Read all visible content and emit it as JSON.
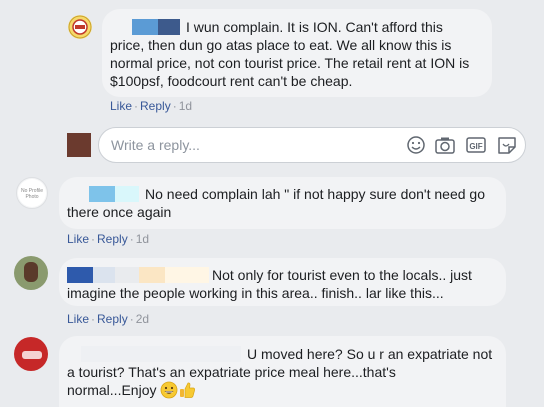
{
  "comments": [
    {
      "lines": [
        "I wun complain. It is ION. Can't afford this",
        "price, then dun go atas place to eat. We all know this is",
        "normal price, not con tourist price. The retail rent at ION is",
        "$100psf, foodcourt rent can't be cheap."
      ],
      "like": "Like",
      "reply": "Reply",
      "time": "1d"
    },
    {
      "lines": [
        "No need complain lah \" if not happy sure don't need go",
        "there once again"
      ],
      "like": "Like",
      "reply": "Reply",
      "time": "1d"
    },
    {
      "lines": [
        "Not only for tourist even to the locals.. just",
        "imagine the people working in this area.. finish.. lar like this..."
      ],
      "like": "Like",
      "reply": "Reply",
      "time": "2d"
    },
    {
      "lines": [
        "U moved here? So u r an expatriate not",
        "a tourist? That's an expatriate price meal here...that's",
        "normal...Enjoy"
      ]
    }
  ],
  "reply_box": {
    "placeholder": "Write a reply..."
  },
  "separator": "·",
  "icons": {
    "emoji": "smiley-icon",
    "camera": "camera-icon",
    "gif": "gif-icon",
    "sticker": "sticker-icon",
    "grin": "grinning-emoji",
    "thumb": "thumbs-up-emoji"
  },
  "avatar_labels": {
    "no_profile_1": "No Profile",
    "no_profile_2": "Photo"
  },
  "colors": {
    "link": "#385898",
    "bubble": "#f2f3f5",
    "background": "#e9ebee",
    "redact_blue": "#5b9bd5",
    "redact_cyan": "#d9f7fb",
    "redact_navy": "#2e5aac",
    "redact_beige": "#fbe6c4"
  }
}
